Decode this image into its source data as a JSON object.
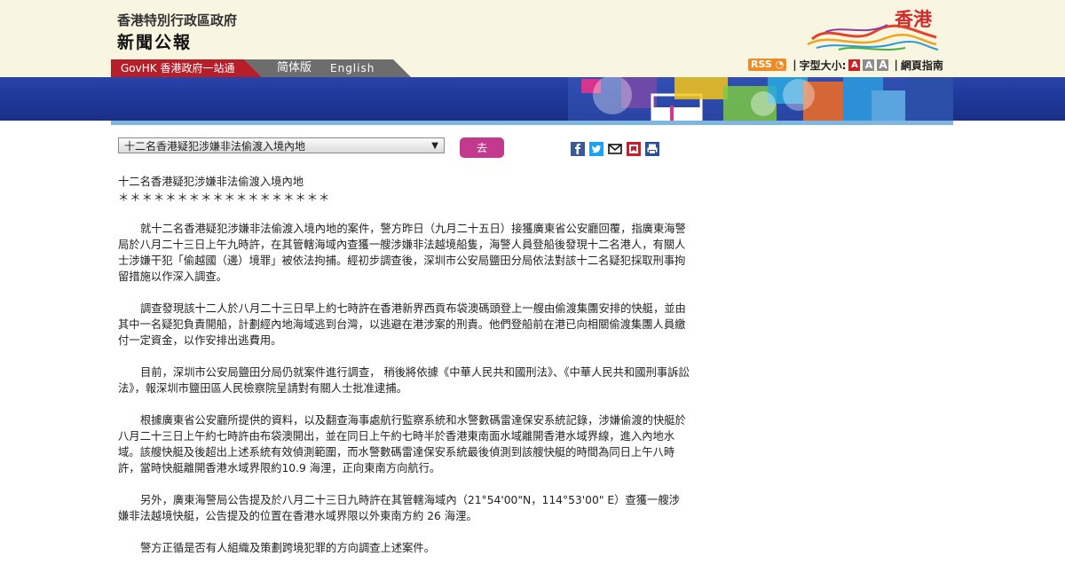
{
  "header": {
    "gov_name": "香港特別行政區政府",
    "section_title": "新聞公報",
    "brand": "香港"
  },
  "nav": {
    "govhk": "GovHK 香港政府一站通",
    "simplified": "简体版",
    "english": "English"
  },
  "tools": {
    "rss": "RSS",
    "font_size_label": "字型大小:",
    "font_sizes": [
      "A",
      "A",
      "A"
    ],
    "site_guide": "網頁指南"
  },
  "selector": {
    "selected": "十二名香港疑犯涉嫌非法偷渡入境內地",
    "go_label": "去"
  },
  "share_icons": [
    "facebook-icon",
    "twitter-icon",
    "email-icon",
    "bookmark-icon",
    "print-icon"
  ],
  "article": {
    "title": "十二名香港疑犯涉嫌非法偷渡入境內地",
    "stars": "＊＊＊＊＊＊＊＊＊＊＊＊＊＊＊＊＊＊",
    "paragraphs": [
      "就十二名香港疑犯涉嫌非法偷渡入境內地的案件，警方昨日（九月二十五日）接獲廣東省公安廳回覆，指廣東海警局於八月二十三日上午九時許，在其管轄海域內查獲一艘涉嫌非法越境船隻，海警人員登船後發現十二名港人，有關人士涉嫌干犯「偷越國（邊）境罪」被依法拘捕。經初步調查後，深圳市公安局鹽田分局依法對該十二名疑犯採取刑事拘留措施以作深入調查。",
      "調查發現該十二人於八月二十三日早上約七時許在香港新界西貢布袋澳碼頭登上一艘由偷渡集團安排的快艇，並由其中一名疑犯負責開船，計劃經內地海域逃到台灣，以逃避在港涉案的刑責。他們登船前在港已向相關偷渡集團人員繳付一定資金，以作安排出逃費用。",
      "目前，深圳市公安局鹽田分局仍就案件進行調查， 稍後將依據《中華人民共和國刑法》、《中華人民共和國刑事訴訟法》，報深圳市鹽田區人民檢察院呈請對有關人士批准逮捕。",
      "根據廣東省公安廳所提供的資料，以及翻查海事處航行監察系統和水警數碼雷達保安系統記錄，涉嫌偷渡的快艇於八月二十三日上午約七時許由布袋澳開出，並在同日上午約七時半於香港東南面水域離開香港水域界線，進入內地水域。該艘快艇及後超出上述系統有效偵測範圍，而水警數碼雷達保安系統最後偵測到該艘快艇的時間為同日上午八時許，當時快艇離開香港水域界限約10.9 海浬，正向東南方向航行。",
      "另外，廣東海警局公告提及於八月二十三日九時許在其管轄海域內（21°54'00\"N，114°53'00\" E）查獲一艘涉嫌非法越境快艇，公告提及的位置在香港水域界限以外東南方約 26 海浬。",
      "警方正循是否有人組織及策劃跨境犯罪的方向調查上述案件。"
    ]
  },
  "colors": {
    "header_bg": "#f8f5e1",
    "govhk_red": "#b51f2a",
    "nav_gray": "#6d6d6d",
    "go_button": "#c2398e",
    "rss_orange": "#f08a24",
    "banner_blue": "#1f3a9c"
  }
}
